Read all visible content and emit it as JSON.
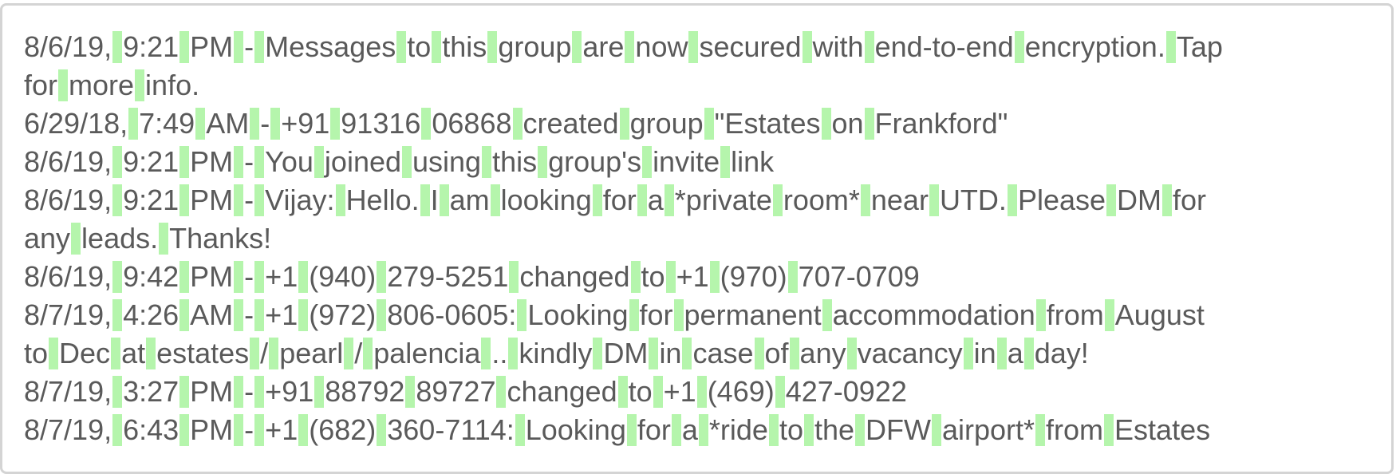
{
  "lines": [
    "8/6/19, 9:21 PM - Messages to this group are now secured with end-to-end encryption. Tap",
    "for more info.",
    "6/29/18, 7:49 AM - +91 91316 06868 created group \"Estates on Frankford\"",
    "8/6/19, 9:21 PM - You joined using this group's invite link",
    "8/6/19, 9:21 PM - Vijay: Hello. I am looking for a *private room* near UTD. Please DM for",
    "any leads. Thanks!",
    "8/6/19, 9:42 PM - +1 (940) 279-5251 changed to +1 (970) 707-0709",
    "8/7/19, 4:26 AM - +1 (972) 806-0605: Looking for permanent accommodation from August",
    "to Dec at estates / pearl / palencia .. kindly DM in case of any vacancy in a day!",
    "8/7/19, 3:27 PM - +91 88792 89727 changed to +1 (469) 427-0922",
    "8/7/19, 6:43 PM - +1 (682) 360-7114: Looking for a *ride to the DFW airport* from Estates"
  ]
}
